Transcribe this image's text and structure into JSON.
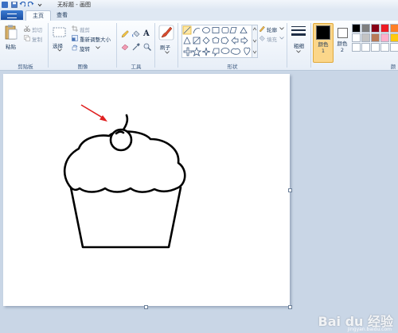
{
  "window": {
    "title": "无标题 - 画图"
  },
  "tabs": [
    {
      "label": "主页"
    },
    {
      "label": "查看"
    }
  ],
  "clipboard": {
    "paste": "粘贴",
    "cut": "剪切",
    "copy": "复制",
    "group": "剪贴板"
  },
  "image": {
    "select": "选择",
    "crop": "裁剪",
    "resize": "重新调整大小",
    "rotate": "旋转",
    "group": "图像"
  },
  "tools": {
    "group": "工具"
  },
  "brushes": {
    "label": "刷子"
  },
  "shapes": {
    "outline": "轮廓",
    "fill": "填充",
    "group": "形状"
  },
  "size": {
    "label": "粗细"
  },
  "colors": {
    "color1": "颜色 1",
    "color2": "颜色 2",
    "group": "颜色",
    "color1_value": "#000000",
    "color2_value": "#ffffff",
    "palette": [
      "#000000",
      "#7f7f7f",
      "#880015",
      "#ed1c24",
      "#ff7f27",
      "#ffffff",
      "#c3c3c3",
      "#b97a57",
      "#ffaec9",
      "#ffc90e",
      "#ffffff",
      "#ffffff",
      "#ffffff",
      "#ffffff",
      "#ffffff"
    ]
  },
  "watermark": {
    "text": "Bai du 经验",
    "sub": "jingyan.baidu.com"
  }
}
